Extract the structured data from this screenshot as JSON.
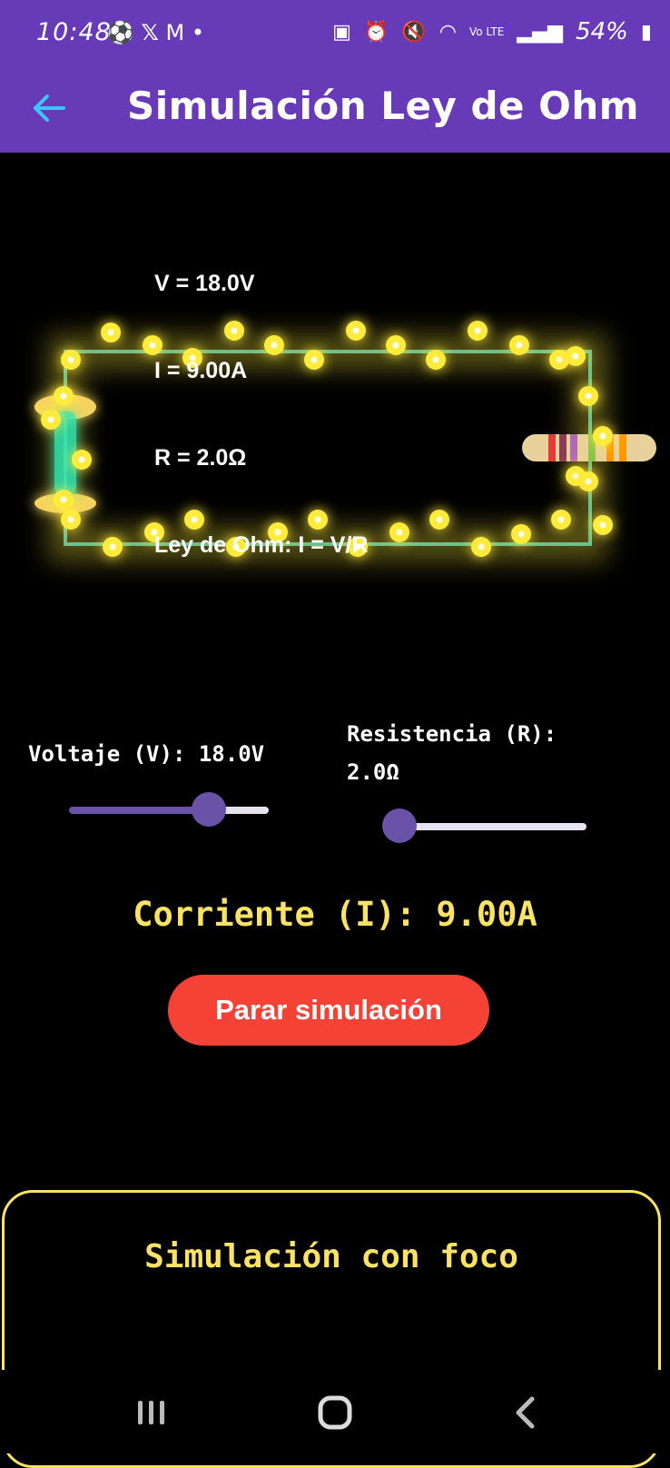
{
  "status_bar": {
    "time": "10:48",
    "left_icons": [
      "soccer-ball-icon",
      "x-logo-icon",
      "gmail-icon",
      "dot-icon"
    ],
    "right_icons": [
      "battery-saver-icon",
      "alarm-icon",
      "mute-icon",
      "wifi-icon",
      "volte-icon",
      "signal-icon"
    ],
    "battery": "54%"
  },
  "app_bar": {
    "title": "Simulación Ley de Ohm",
    "back_icon": "arrow-back-icon",
    "background": "#673AB7",
    "back_icon_color": "#40C4FF"
  },
  "circuit": {
    "voltage_label": "V = 18.0V",
    "current_label": "I = 9.00A",
    "resistance_label": "R = 2.0Ω",
    "law_label": "Ley de Ohm: I = V/R",
    "wire_color": "#6FBF8A",
    "electron_color": "#FFEB3B"
  },
  "controls": {
    "voltage": {
      "label": "Voltaje (V): 18.0V",
      "fraction": 0.7
    },
    "resistance": {
      "label_line1": "Resistencia (R):",
      "label_line2": "2.0Ω",
      "fraction": 0.0
    }
  },
  "result": {
    "current_text": "Corriente (I): 9.00A",
    "color": "#F9E264"
  },
  "stop_button": {
    "label": "Parar simulación",
    "color": "#F44336"
  },
  "bulb_card": {
    "title": "Simulación con foco"
  },
  "nav_bar": {
    "icons": [
      "recent-apps-icon",
      "home-icon",
      "back-nav-icon"
    ]
  }
}
